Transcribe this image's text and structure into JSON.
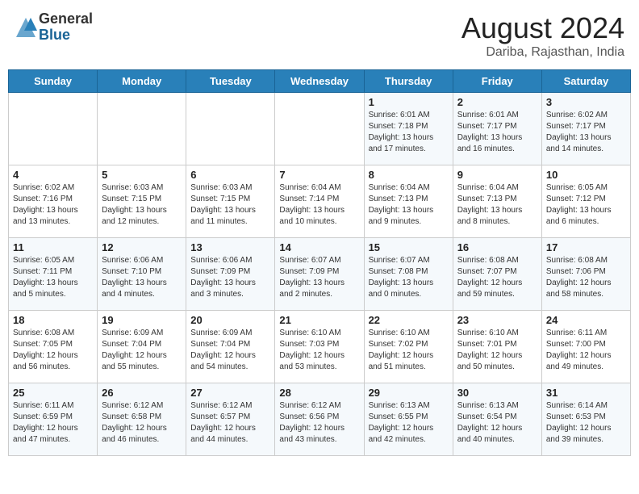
{
  "header": {
    "logo_general": "General",
    "logo_blue": "Blue",
    "month_title": "August 2024",
    "location": "Dariba, Rajasthan, India"
  },
  "days_of_week": [
    "Sunday",
    "Monday",
    "Tuesday",
    "Wednesday",
    "Thursday",
    "Friday",
    "Saturday"
  ],
  "weeks": [
    [
      {
        "day": "",
        "content": ""
      },
      {
        "day": "",
        "content": ""
      },
      {
        "day": "",
        "content": ""
      },
      {
        "day": "",
        "content": ""
      },
      {
        "day": "1",
        "content": "Sunrise: 6:01 AM\nSunset: 7:18 PM\nDaylight: 13 hours\nand 17 minutes."
      },
      {
        "day": "2",
        "content": "Sunrise: 6:01 AM\nSunset: 7:17 PM\nDaylight: 13 hours\nand 16 minutes."
      },
      {
        "day": "3",
        "content": "Sunrise: 6:02 AM\nSunset: 7:17 PM\nDaylight: 13 hours\nand 14 minutes."
      }
    ],
    [
      {
        "day": "4",
        "content": "Sunrise: 6:02 AM\nSunset: 7:16 PM\nDaylight: 13 hours\nand 13 minutes."
      },
      {
        "day": "5",
        "content": "Sunrise: 6:03 AM\nSunset: 7:15 PM\nDaylight: 13 hours\nand 12 minutes."
      },
      {
        "day": "6",
        "content": "Sunrise: 6:03 AM\nSunset: 7:15 PM\nDaylight: 13 hours\nand 11 minutes."
      },
      {
        "day": "7",
        "content": "Sunrise: 6:04 AM\nSunset: 7:14 PM\nDaylight: 13 hours\nand 10 minutes."
      },
      {
        "day": "8",
        "content": "Sunrise: 6:04 AM\nSunset: 7:13 PM\nDaylight: 13 hours\nand 9 minutes."
      },
      {
        "day": "9",
        "content": "Sunrise: 6:04 AM\nSunset: 7:13 PM\nDaylight: 13 hours\nand 8 minutes."
      },
      {
        "day": "10",
        "content": "Sunrise: 6:05 AM\nSunset: 7:12 PM\nDaylight: 13 hours\nand 6 minutes."
      }
    ],
    [
      {
        "day": "11",
        "content": "Sunrise: 6:05 AM\nSunset: 7:11 PM\nDaylight: 13 hours\nand 5 minutes."
      },
      {
        "day": "12",
        "content": "Sunrise: 6:06 AM\nSunset: 7:10 PM\nDaylight: 13 hours\nand 4 minutes."
      },
      {
        "day": "13",
        "content": "Sunrise: 6:06 AM\nSunset: 7:09 PM\nDaylight: 13 hours\nand 3 minutes."
      },
      {
        "day": "14",
        "content": "Sunrise: 6:07 AM\nSunset: 7:09 PM\nDaylight: 13 hours\nand 2 minutes."
      },
      {
        "day": "15",
        "content": "Sunrise: 6:07 AM\nSunset: 7:08 PM\nDaylight: 13 hours\nand 0 minutes."
      },
      {
        "day": "16",
        "content": "Sunrise: 6:08 AM\nSunset: 7:07 PM\nDaylight: 12 hours\nand 59 minutes."
      },
      {
        "day": "17",
        "content": "Sunrise: 6:08 AM\nSunset: 7:06 PM\nDaylight: 12 hours\nand 58 minutes."
      }
    ],
    [
      {
        "day": "18",
        "content": "Sunrise: 6:08 AM\nSunset: 7:05 PM\nDaylight: 12 hours\nand 56 minutes."
      },
      {
        "day": "19",
        "content": "Sunrise: 6:09 AM\nSunset: 7:04 PM\nDaylight: 12 hours\nand 55 minutes."
      },
      {
        "day": "20",
        "content": "Sunrise: 6:09 AM\nSunset: 7:04 PM\nDaylight: 12 hours\nand 54 minutes."
      },
      {
        "day": "21",
        "content": "Sunrise: 6:10 AM\nSunset: 7:03 PM\nDaylight: 12 hours\nand 53 minutes."
      },
      {
        "day": "22",
        "content": "Sunrise: 6:10 AM\nSunset: 7:02 PM\nDaylight: 12 hours\nand 51 minutes."
      },
      {
        "day": "23",
        "content": "Sunrise: 6:10 AM\nSunset: 7:01 PM\nDaylight: 12 hours\nand 50 minutes."
      },
      {
        "day": "24",
        "content": "Sunrise: 6:11 AM\nSunset: 7:00 PM\nDaylight: 12 hours\nand 49 minutes."
      }
    ],
    [
      {
        "day": "25",
        "content": "Sunrise: 6:11 AM\nSunset: 6:59 PM\nDaylight: 12 hours\nand 47 minutes."
      },
      {
        "day": "26",
        "content": "Sunrise: 6:12 AM\nSunset: 6:58 PM\nDaylight: 12 hours\nand 46 minutes."
      },
      {
        "day": "27",
        "content": "Sunrise: 6:12 AM\nSunset: 6:57 PM\nDaylight: 12 hours\nand 44 minutes."
      },
      {
        "day": "28",
        "content": "Sunrise: 6:12 AM\nSunset: 6:56 PM\nDaylight: 12 hours\nand 43 minutes."
      },
      {
        "day": "29",
        "content": "Sunrise: 6:13 AM\nSunset: 6:55 PM\nDaylight: 12 hours\nand 42 minutes."
      },
      {
        "day": "30",
        "content": "Sunrise: 6:13 AM\nSunset: 6:54 PM\nDaylight: 12 hours\nand 40 minutes."
      },
      {
        "day": "31",
        "content": "Sunrise: 6:14 AM\nSunset: 6:53 PM\nDaylight: 12 hours\nand 39 minutes."
      }
    ]
  ]
}
